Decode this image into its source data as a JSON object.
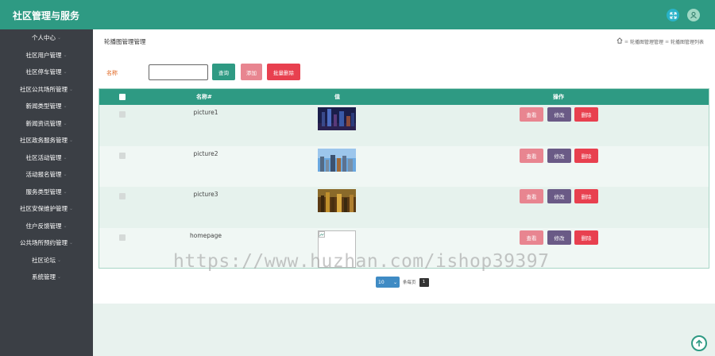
{
  "app": {
    "title": "社区管理与服务"
  },
  "sidebar": {
    "items": [
      {
        "label": "个人中心"
      },
      {
        "label": "社区用户管理"
      },
      {
        "label": "社区停车管理"
      },
      {
        "label": "社区公共场所管理"
      },
      {
        "label": "新闻类型管理"
      },
      {
        "label": "新闻资讯管理"
      },
      {
        "label": "社区政务服务管理"
      },
      {
        "label": "社区活动管理"
      },
      {
        "label": "活动报名管理"
      },
      {
        "label": "服务类型管理"
      },
      {
        "label": "社区安保维护管理"
      },
      {
        "label": "住户反馈管理"
      },
      {
        "label": "公共场所预约管理"
      },
      {
        "label": "社区论坛"
      },
      {
        "label": "系统管理"
      }
    ]
  },
  "page": {
    "heading": "轮播图管理管理",
    "breadcrumb": [
      "轮播图管理管理",
      "轮播图管理列表"
    ]
  },
  "search": {
    "label": "名称",
    "value": "",
    "placeholder": "",
    "query_label": "查询",
    "add_label": "添加",
    "batch_delete_label": "批量删除"
  },
  "table": {
    "columns": {
      "name": "名称#",
      "value": "值",
      "actions": "操作"
    },
    "rows": [
      {
        "name": "picture1",
        "image": "night city skyline"
      },
      {
        "name": "picture2",
        "image": "city skyline under blue sky"
      },
      {
        "name": "picture3",
        "image": "city at dusk"
      },
      {
        "name": "homepage",
        "image": "broken image"
      }
    ],
    "actions": {
      "view": "查看",
      "edit": "修改",
      "delete": "删除"
    }
  },
  "pagination": {
    "page_size": "10",
    "per_page_label": "条每页",
    "current_page": "1"
  },
  "watermark": "https://www.huzhan.com/ishop39397",
  "colors": {
    "primary": "#2e9a83",
    "sidebar": "#3b3f45",
    "view": "#e88590",
    "edit": "#6a5a86",
    "delete": "#e8404f"
  }
}
